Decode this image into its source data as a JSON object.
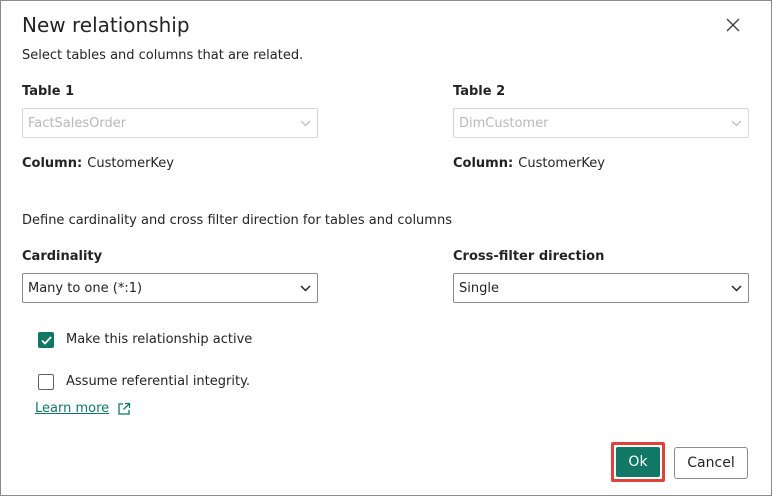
{
  "dialog": {
    "title": "New relationship",
    "subtitle": "Select tables and columns that are related."
  },
  "table1": {
    "label": "Table 1",
    "value": "FactSalesOrder",
    "column_label": "Column:",
    "column_value": "CustomerKey"
  },
  "table2": {
    "label": "Table 2",
    "value": "DimCustomer",
    "column_label": "Column:",
    "column_value": "CustomerKey"
  },
  "cardinality_section": {
    "description": "Define cardinality and cross filter direction for tables and columns",
    "cardinality_label": "Cardinality",
    "cardinality_value": "Many to one (*:1)",
    "crossfilter_label": "Cross-filter direction",
    "crossfilter_value": "Single"
  },
  "options": {
    "active_label": "Make this relationship active",
    "active_checked": true,
    "integrity_label": "Assume referential integrity.",
    "integrity_checked": false,
    "learn_more": "Learn more"
  },
  "footer": {
    "ok_label": "Ok",
    "cancel_label": "Cancel"
  },
  "colors": {
    "accent": "#117865",
    "highlight": "#e0413a"
  },
  "icons": {
    "close": "close-icon",
    "chevron": "chevron-down-icon",
    "check": "checkmark-icon",
    "external": "external-link-icon"
  }
}
